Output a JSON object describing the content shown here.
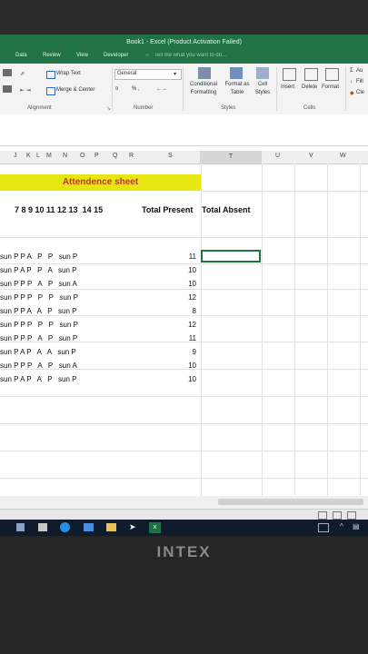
{
  "window": {
    "title": "Book1 - Excel (Product Activation Failed)"
  },
  "tabs": [
    "Data",
    "Review",
    "View",
    "Developer"
  ],
  "tell_me": "Tell me what you want to do...",
  "ribbon": {
    "wrap_text": "Wrap Text",
    "merge_center": "Merge & Center",
    "number_format": "General",
    "number_symbols": "% ,",
    "conditional_formatting": "Conditional Formatting",
    "format_as_table": "Format as Table",
    "cell_styles": "Cell Styles",
    "insert": "Insert",
    "delete": "Delete",
    "format": "Format",
    "autosum": "Au",
    "fill": "Fill",
    "clear": "Cle",
    "groups": {
      "alignment": "Alignment",
      "number": "Number",
      "styles": "Styles",
      "cells": "Cells"
    }
  },
  "columns": [
    "J",
    "K",
    "L",
    "M",
    "N",
    "O",
    "P",
    "Q",
    "R",
    "S",
    "T",
    "U",
    "V",
    "W"
  ],
  "sheet": {
    "banner": "Attendence sheet",
    "header_days": "7 8 9 10 11 12 13  14 15",
    "header_present": "Total Present",
    "header_absent": "Total Absent",
    "rows": [
      {
        "marks": "sun P P A   P   P   sun P",
        "present": "11"
      },
      {
        "marks": "sun P A P   P   A   sun P",
        "present": "10"
      },
      {
        "marks": "sun P P P   A   P   sun A",
        "present": "10"
      },
      {
        "marks": "sun P P P   P   P   sun P",
        "present": "12"
      },
      {
        "marks": "sun P P A   A   P   sun P",
        "present": "8"
      },
      {
        "marks": "sun P P P   P   P   sun P",
        "present": "12"
      },
      {
        "marks": "sun P P P   A   P   sun P",
        "present": "11"
      },
      {
        "marks": "sun P A P   A   A   sun P",
        "present": "9"
      },
      {
        "marks": "sun P P P   A   P   sun A",
        "present": "10"
      },
      {
        "marks": "sun P A P   A   P   sun P",
        "present": "10"
      }
    ]
  },
  "brand": "INTEX",
  "colors": {
    "excel_green": "#217346",
    "banner_yellow": "#e6e613",
    "banner_text": "#c0392b"
  }
}
